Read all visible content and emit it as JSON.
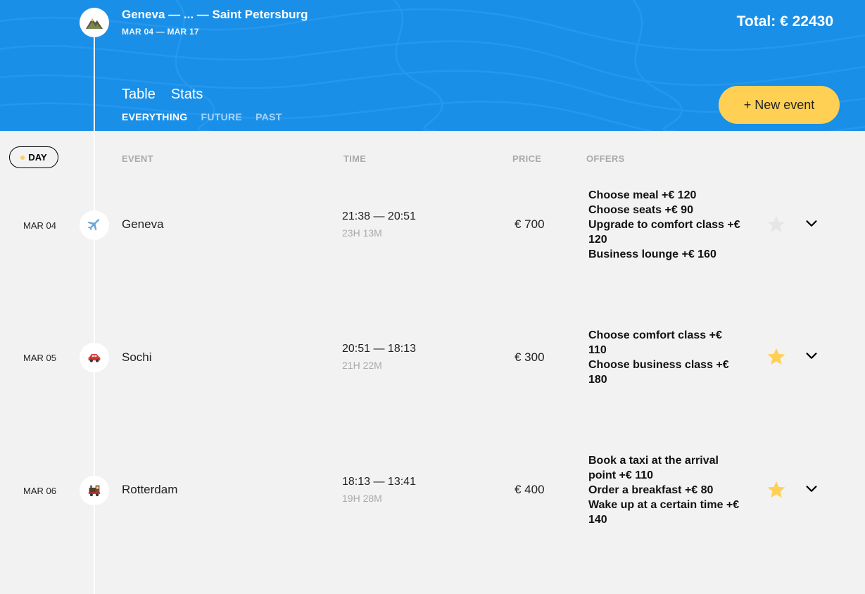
{
  "trip": {
    "title": "Geneva — ... — Saint Petersburg",
    "dates": "MAR 04 — MAR 17",
    "total": "Total: € 22430"
  },
  "views": [
    "Table",
    "Stats"
  ],
  "filters": [
    "EVERYTHING",
    "FUTURE",
    "PAST"
  ],
  "new_event_label": "+ New event",
  "sort": {
    "day_label": "DAY",
    "event_label": "EVENT",
    "time_label": "TIME",
    "price_label": "PRICE",
    "offers_label": "OFFERS"
  },
  "events": [
    {
      "date": "MAR 04",
      "icon": "airplane-icon",
      "destination": "Geneva",
      "time": "21:38 — 20:51",
      "duration": "23H 13M",
      "price": "€ 700",
      "offers": [
        "Choose meal +€  120",
        "Choose seats +€  90",
        "Upgrade to comfort class +€  120",
        "Business lounge +€  160"
      ],
      "favorite": false
    },
    {
      "date": "MAR 05",
      "icon": "car-icon",
      "destination": "Sochi",
      "time": "20:51 — 18:13",
      "duration": "21H 22M",
      "price": "€ 300",
      "offers": [
        "Choose comfort class +€  110",
        "Choose business class +€  180"
      ],
      "favorite": true
    },
    {
      "date": "MAR 06",
      "icon": "train-icon",
      "destination": "Rotterdam",
      "time": "18:13 — 13:41",
      "duration": "19H 28M",
      "price": "€ 400",
      "offers": [
        "Book a taxi at the arrival point +€  110",
        "Order a breakfast +€  80",
        "Wake up at a certain time +€  140"
      ],
      "favorite": true
    }
  ],
  "colors": {
    "header_bg": "#1a8fe8",
    "accent": "#ffd054",
    "page_bg": "#f2f2f2",
    "muted": "#aaaaaa",
    "star_off": "#e6e6e6"
  }
}
